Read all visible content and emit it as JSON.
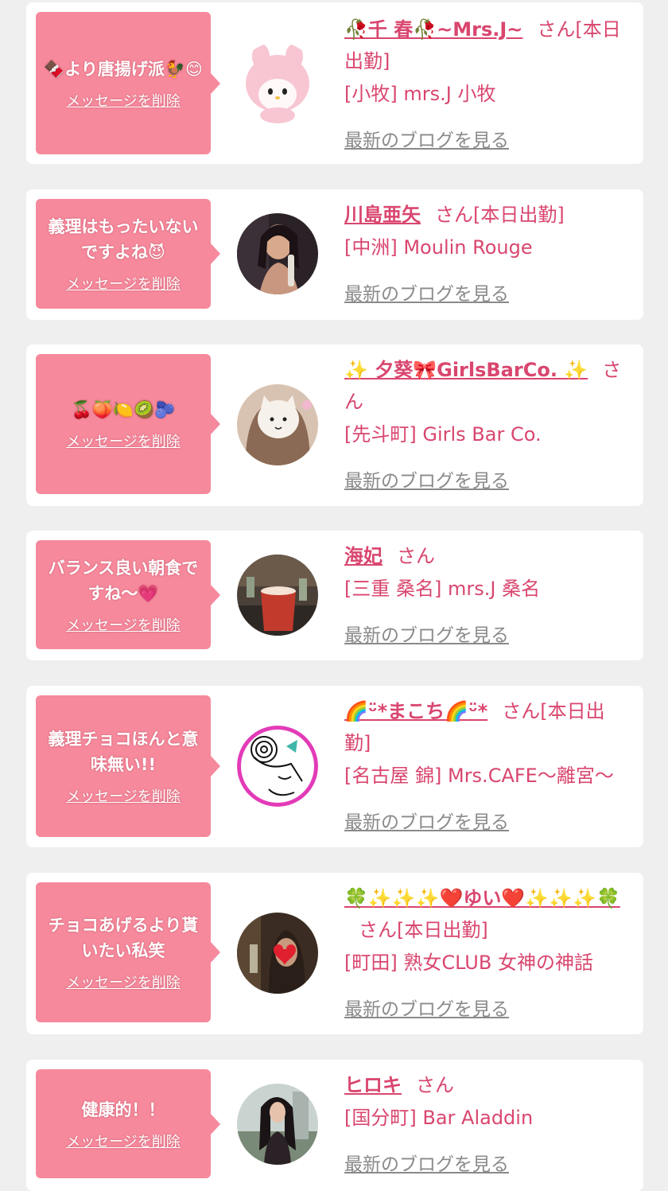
{
  "cards": [
    {
      "message": "🍫より唐揚げ派🐓😊",
      "delete_label": "メッセージを削除",
      "name": "🥀千 春🥀~Mrs.J~",
      "suffix": "さん[本日出勤]",
      "shop": "[小牧] mrs.J 小牧",
      "blog_label": "最新のブログを見る",
      "avatar_icon": "plush-toy-icon"
    },
    {
      "message": "義理はもったいないですよね😈",
      "delete_label": "メッセージを削除",
      "name": "川島亜矢",
      "suffix": "さん[本日出勤]",
      "shop": "[中洲] Moulin Rouge",
      "blog_label": "最新のブログを見る",
      "avatar_icon": "woman-photo-icon"
    },
    {
      "message": "🍒🍑🍋🥝🫐",
      "delete_label": "メッセージを削除",
      "name": "✨ 夕葵🎀GirlsBarCo. ✨",
      "suffix": "さん",
      "shop": "[先斗町] Girls Bar Co.",
      "blog_label": "最新のブログを見る",
      "avatar_icon": "woman-photo-icon"
    },
    {
      "message": "バランス良い朝食ですね〜💗",
      "delete_label": "メッセージを削除",
      "name": "海妃",
      "suffix": "さん",
      "shop": "[三重 桑名] mrs.J 桑名",
      "blog_label": "最新のブログを見る",
      "avatar_icon": "drink-photo-icon"
    },
    {
      "message": "義理チョコほんと意味無い!!",
      "delete_label": "メッセージを削除",
      "name": "🌈ᵕ̈*まこち🌈ᵕ̈*",
      "suffix": "さん[本日出勤]",
      "shop": "[名古屋 錦] Mrs.CAFE〜離宮〜",
      "blog_label": "最新のブログを見る",
      "avatar_icon": "drawing-icon"
    },
    {
      "message": "チョコあげるより貰いたい私笑",
      "delete_label": "メッセージを削除",
      "name": "🍀✨✨✨❤️ゆい❤️✨✨✨🍀",
      "suffix": "さん[本日出勤]",
      "shop": "[町田] 熟女CLUB 女神の神話",
      "blog_label": "最新のブログを見る",
      "avatar_icon": "heart-photo-icon"
    },
    {
      "message": "健康的！！",
      "delete_label": "メッセージを削除",
      "name": "ヒロキ",
      "suffix": "さん",
      "shop": "[国分町] Bar Aladdin",
      "blog_label": "最新のブログを見る",
      "avatar_icon": "woman-photo-icon"
    }
  ]
}
